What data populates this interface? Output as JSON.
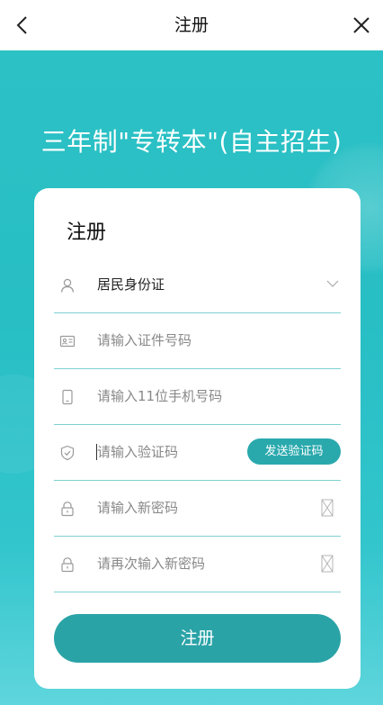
{
  "navbar": {
    "title": "注册",
    "back_icon": "chevron-left-icon",
    "close_icon": "close-icon"
  },
  "hero": {
    "headline": "三年制\"专转本\"(自主招生)"
  },
  "form": {
    "title": "注册",
    "id_type": {
      "value": "居民身份证",
      "icon": "user-icon"
    },
    "id_number": {
      "placeholder": "请输入证件号码",
      "icon": "id-card-icon"
    },
    "phone": {
      "placeholder": "请输入11位手机号码",
      "icon": "phone-icon"
    },
    "code": {
      "placeholder": "请输入验证码",
      "icon": "shield-icon",
      "send_label": "发送验证码"
    },
    "password": {
      "placeholder": "请输入新密码",
      "icon": "lock-icon"
    },
    "password_confirm": {
      "placeholder": "请再次输入新密码",
      "icon": "lock-icon"
    },
    "submit_label": "注册"
  },
  "colors": {
    "accent": "#2aa9ad",
    "background": "#2cc1c5",
    "divider": "#7fd0d2"
  }
}
